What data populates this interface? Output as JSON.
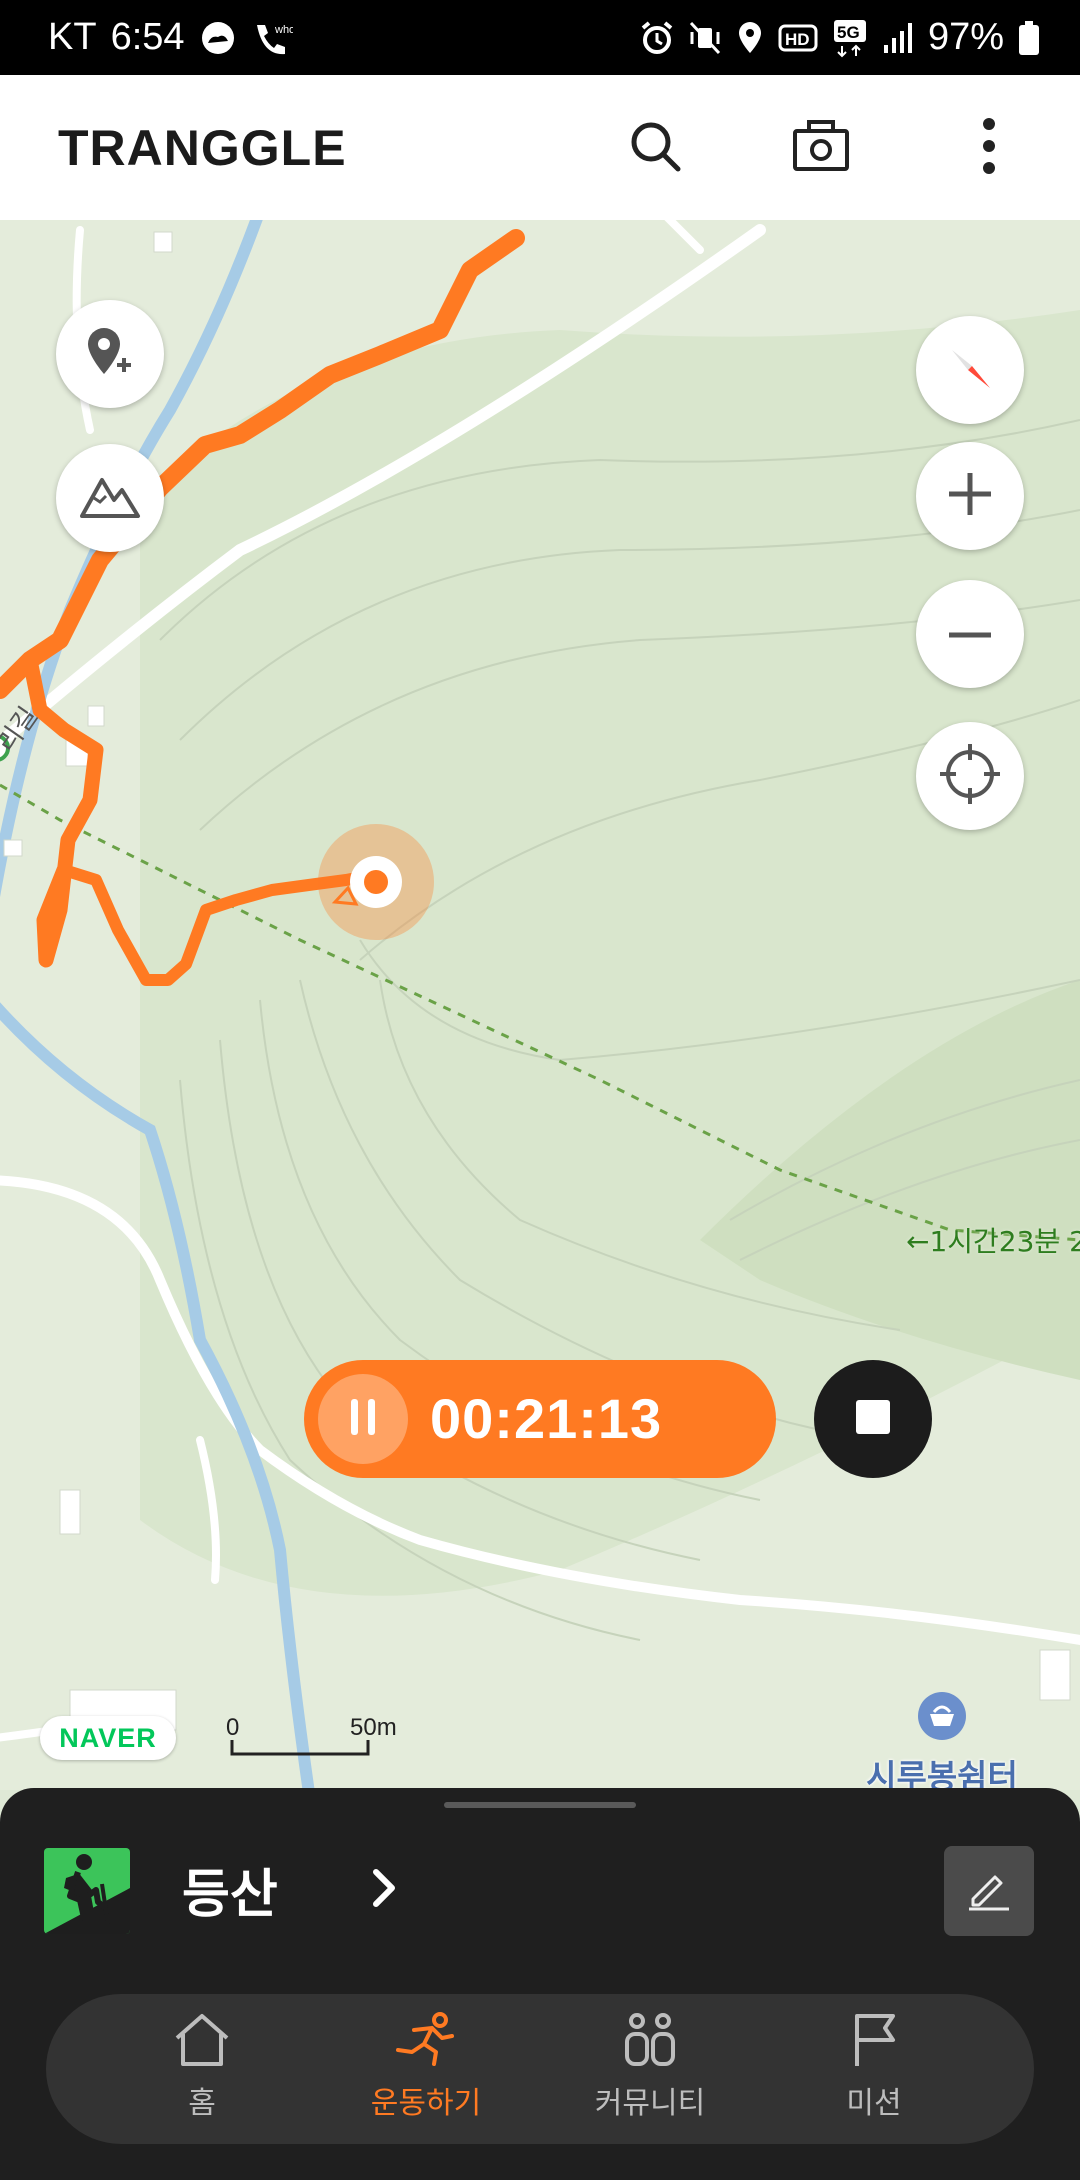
{
  "status_bar": {
    "carrier": "KT",
    "time": "6:54",
    "battery": "97%",
    "network": "5G"
  },
  "header": {
    "logo": "TRANGGLE",
    "icons": [
      "search-icon",
      "camera-icon",
      "more-vert-icon"
    ]
  },
  "map": {
    "route_color": "#ff7a22",
    "road_label": "리길",
    "time_label": "←1시간23분 2",
    "poi": {
      "name": "시루봉쉼터"
    },
    "attribution": "NAVER",
    "scale": {
      "zero": "0",
      "max": "50m"
    }
  },
  "controls": {
    "left_buttons": [
      "add-location-icon",
      "mountain-icon"
    ],
    "right_buttons": [
      "compass-icon",
      "zoom-in-icon",
      "zoom-out-icon",
      "locate-icon"
    ]
  },
  "recording": {
    "timer": "00:21:13",
    "accent": "#ff7a22"
  },
  "activity": {
    "name": "등산"
  },
  "bottom_nav": {
    "items": [
      {
        "label": "홈",
        "icon": "home-icon"
      },
      {
        "label": "운동하기",
        "icon": "running-icon",
        "active": true
      },
      {
        "label": "커뮤니티",
        "icon": "community-icon"
      },
      {
        "label": "미션",
        "icon": "flag-icon"
      }
    ]
  }
}
